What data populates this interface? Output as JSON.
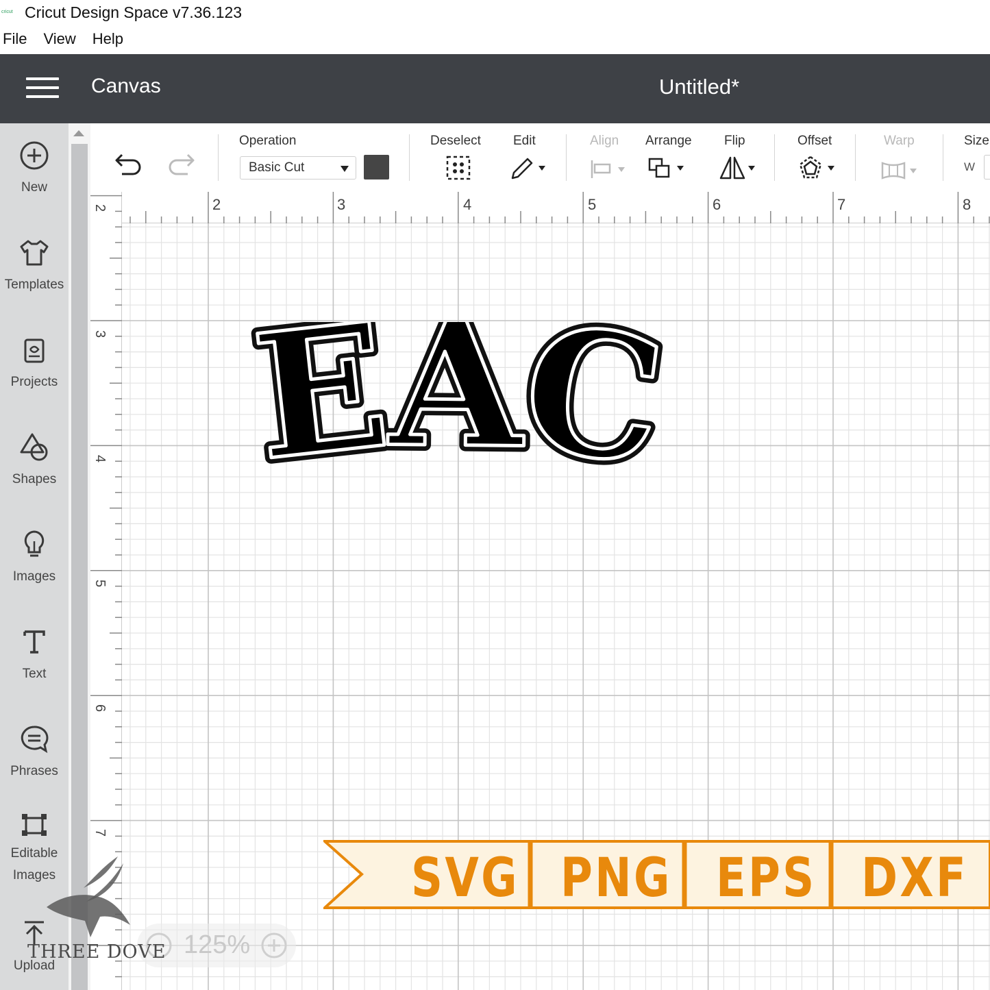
{
  "window": {
    "logo_text": "cricut",
    "title": "Cricut Design Space  v7.36.123"
  },
  "menu": [
    "File",
    "View",
    "Help"
  ],
  "header": {
    "section": "Canvas",
    "document": "Untitled*"
  },
  "sidebar": [
    {
      "label": "New",
      "icon": "plus-circle-icon"
    },
    {
      "label": "Templates",
      "icon": "tshirt-icon"
    },
    {
      "label": "Projects",
      "icon": "project-icon"
    },
    {
      "label": "Shapes",
      "icon": "shapes-icon"
    },
    {
      "label": "Images",
      "icon": "lightbulb-icon"
    },
    {
      "label": "Text",
      "icon": "text-icon"
    },
    {
      "label": "Phrases",
      "icon": "speech-bubble-icon"
    },
    {
      "label": "Editable",
      "label2": "Images",
      "icon": "editable-images-icon"
    },
    {
      "label": "Upload",
      "icon": "upload-icon"
    }
  ],
  "toolbar": {
    "operation_label": "Operation",
    "operation_value": "Basic Cut",
    "swatch_color": "#454545",
    "deselect_label": "Deselect",
    "edit_label": "Edit",
    "align_label": "Align",
    "arrange_label": "Arrange",
    "flip_label": "Flip",
    "offset_label": "Offset",
    "warp_label": "Warp",
    "size_label": "Size",
    "size_w_label": "W"
  },
  "ruler": {
    "horizontal": [
      "2",
      "2",
      "3",
      "4",
      "5",
      "6",
      "7",
      "8"
    ],
    "vertical": [
      "3",
      "4",
      "5",
      "6",
      "7"
    ]
  },
  "canvas": {
    "design_text": "TEACH"
  },
  "banner": {
    "formats": [
      "SVG",
      "PNG",
      "EPS",
      "DXF"
    ],
    "color": "#e8890c"
  },
  "zoom": {
    "value": "125%"
  },
  "watermark": {
    "text": "THREE DOVE"
  }
}
